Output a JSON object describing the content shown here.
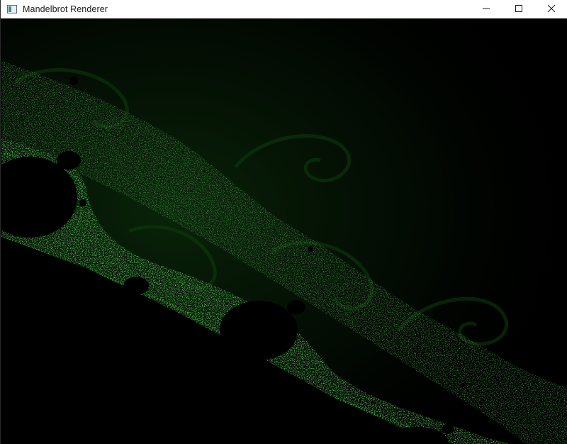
{
  "window": {
    "title": "Mandelbrot Renderer",
    "app_icon": "window-app-icon",
    "controls": {
      "minimize": "minimize-icon",
      "maximize": "maximize-icon",
      "close": "close-icon"
    }
  },
  "render": {
    "background_color": "#000000",
    "glow_color": "#0b2a0b",
    "filament_color": "#1fa01f",
    "bright_color": "#3ee03e"
  }
}
